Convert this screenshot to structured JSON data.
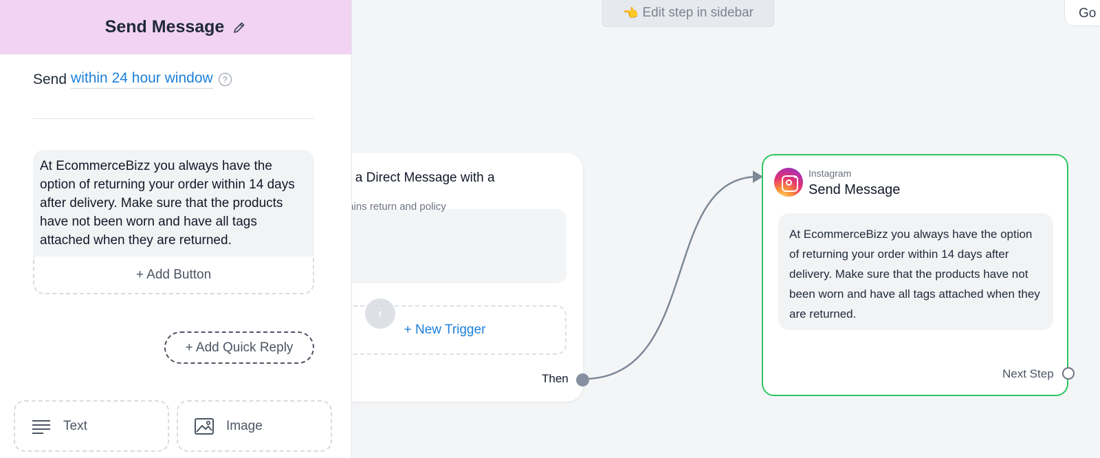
{
  "canvas": {
    "edit_hint_icon": "👈",
    "edit_hint": "Edit step in sidebar",
    "go_label": "Go"
  },
  "trigger": {
    "title_partial": "s a Direct Message with a",
    "subtitle_partial": "tains return and policy",
    "new_trigger": "+ New Trigger",
    "then_label": "Then"
  },
  "action": {
    "platform": "Instagram",
    "title": "Send Message",
    "message": "At EcommerceBizz you always have the option of returning your order within 14 days after delivery. Make sure that the products have not been worn and have all tags attached when they are returned.",
    "next_step": "Next Step"
  },
  "sidebar": {
    "title": "Send Message",
    "send_label": "Send",
    "window_link": "within 24 hour window",
    "help": "?",
    "message": "At EcommerceBizz you always have the option of returning your order within 14 days after delivery. Make sure that the products have not been worn and have all tags attached when they are returned.",
    "add_button": "+ Add Button",
    "add_quick_reply": "+ Add Quick Reply",
    "tools": {
      "text": "Text",
      "image": "Image"
    }
  },
  "colors": {
    "header_bg": "#f2d3f3",
    "link": "#1d7fd9",
    "active_border": "#2cc55f",
    "canvas_bg": "#f4f5f7"
  }
}
